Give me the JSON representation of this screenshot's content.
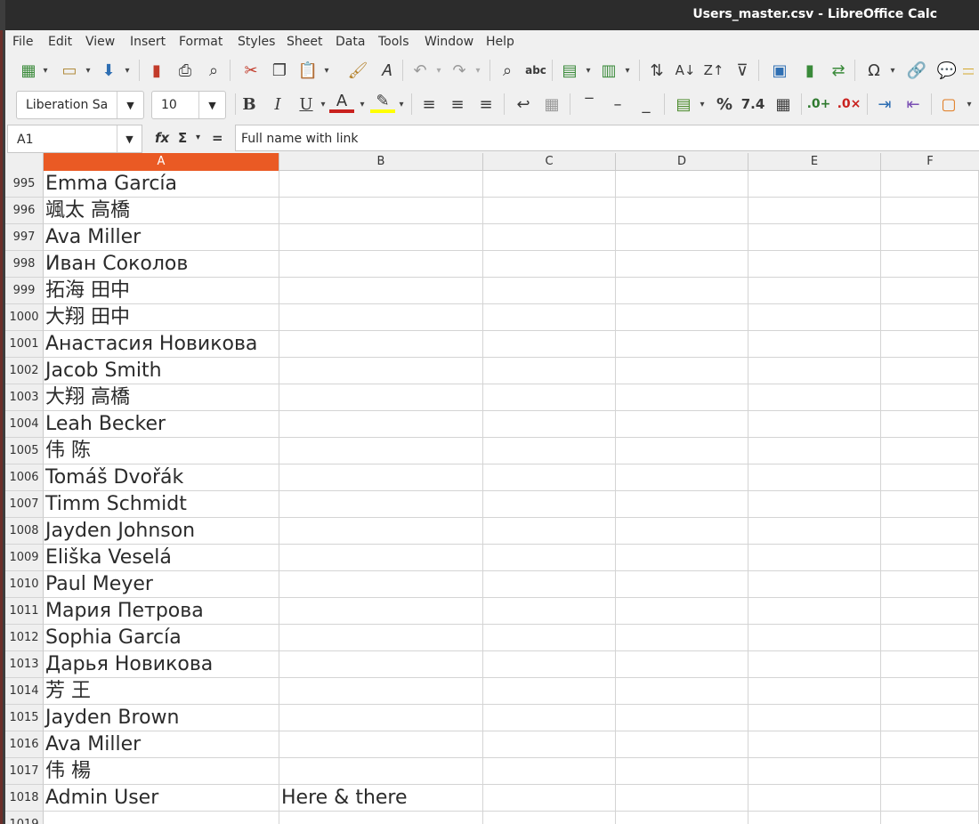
{
  "window": {
    "title": "Users_master.csv - LibreOffice Calc"
  },
  "menu": [
    "File",
    "Edit",
    "View",
    "Insert",
    "Format",
    "Styles",
    "Sheet",
    "Data",
    "Tools",
    "Window",
    "Help"
  ],
  "formatting": {
    "font_name": "Liberation Sa",
    "font_size": "10"
  },
  "formula_bar": {
    "cell_ref": "A1",
    "content": "Full name with link",
    "fx_label": "fx",
    "sum_label": "Σ",
    "equals_label": "="
  },
  "columns": [
    "A",
    "B",
    "C",
    "D",
    "E",
    "F"
  ],
  "selected_column": "A",
  "rows": [
    {
      "num": "995",
      "a": "Emma García",
      "b": ""
    },
    {
      "num": "996",
      "a": "颯太 高橋",
      "b": ""
    },
    {
      "num": "997",
      "a": "Ava Miller",
      "b": ""
    },
    {
      "num": "998",
      "a": "Иван Соколов",
      "b": ""
    },
    {
      "num": "999",
      "a": "拓海 田中",
      "b": ""
    },
    {
      "num": "1000",
      "a": "大翔 田中",
      "b": ""
    },
    {
      "num": "1001",
      "a": "Анастасия Новикова",
      "b": ""
    },
    {
      "num": "1002",
      "a": "Jacob Smith",
      "b": ""
    },
    {
      "num": "1003",
      "a": "大翔 高橋",
      "b": ""
    },
    {
      "num": "1004",
      "a": "Leah Becker",
      "b": ""
    },
    {
      "num": "1005",
      "a": "伟 陈",
      "b": ""
    },
    {
      "num": "1006",
      "a": "Tomáš Dvořák",
      "b": ""
    },
    {
      "num": "1007",
      "a": "Timm Schmidt",
      "b": ""
    },
    {
      "num": "1008",
      "a": "Jayden Johnson",
      "b": ""
    },
    {
      "num": "1009",
      "a": "Eliška Veselá",
      "b": ""
    },
    {
      "num": "1010",
      "a": "Paul Meyer",
      "b": ""
    },
    {
      "num": "1011",
      "a": "Мария Петрова",
      "b": ""
    },
    {
      "num": "1012",
      "a": "Sophia García",
      "b": ""
    },
    {
      "num": "1013",
      "a": "Дарья Новикова",
      "b": ""
    },
    {
      "num": "1014",
      "a": "芳 王",
      "b": ""
    },
    {
      "num": "1015",
      "a": "Jayden Brown",
      "b": ""
    },
    {
      "num": "1016",
      "a": "Ava Miller",
      "b": ""
    },
    {
      "num": "1017",
      "a": "伟 楊",
      "b": ""
    },
    {
      "num": "1018",
      "a": "Admin User",
      "b": "Here & there"
    },
    {
      "num": "1019",
      "a": "",
      "b": ""
    }
  ]
}
